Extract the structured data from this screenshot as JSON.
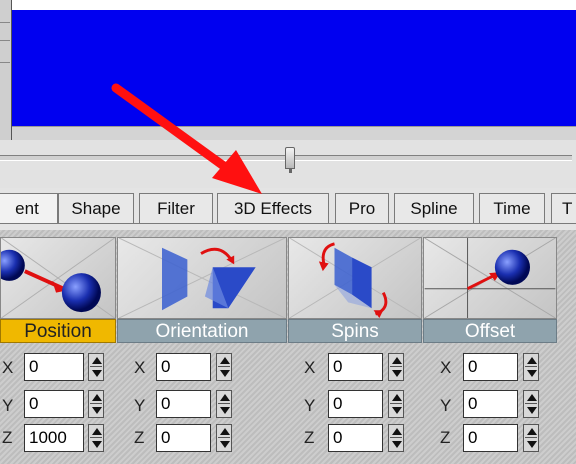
{
  "tabs": [
    {
      "label": "ent",
      "active": true
    },
    {
      "label": "Shape"
    },
    {
      "label": "Filter"
    },
    {
      "label": "3D Effects"
    },
    {
      "label": "Pro"
    },
    {
      "label": "Spline"
    },
    {
      "label": "Time"
    },
    {
      "label": "T"
    }
  ],
  "panels": [
    {
      "label": "Position",
      "active": true,
      "icon": "position-icon",
      "fields": [
        {
          "axis": "X",
          "value": "0"
        },
        {
          "axis": "Y",
          "value": "0"
        },
        {
          "axis": "Z",
          "value": "1000"
        }
      ]
    },
    {
      "label": "Orientation",
      "icon": "orientation-icon",
      "fields": [
        {
          "axis": "X",
          "value": "0"
        },
        {
          "axis": "Y",
          "value": "0"
        },
        {
          "axis": "Z",
          "value": "0"
        }
      ]
    },
    {
      "label": "Spins",
      "icon": "spins-icon",
      "fields": [
        {
          "axis": "X",
          "value": "0"
        },
        {
          "axis": "Y",
          "value": "0"
        },
        {
          "axis": "Z",
          "value": "0"
        }
      ]
    },
    {
      "label": "Offset",
      "icon": "offset-icon",
      "fields": [
        {
          "axis": "X",
          "value": "0"
        },
        {
          "axis": "Y",
          "value": "0"
        },
        {
          "axis": "Z",
          "value": "0"
        }
      ]
    }
  ],
  "colors": {
    "preview": "#0000f0",
    "active_label": "#f0b800",
    "inactive_label": "#8fa3ad",
    "annotation_arrow": "#ff1010"
  },
  "annotation": {
    "icon": "red-arrow-annotation",
    "points_to": "3D Effects"
  }
}
